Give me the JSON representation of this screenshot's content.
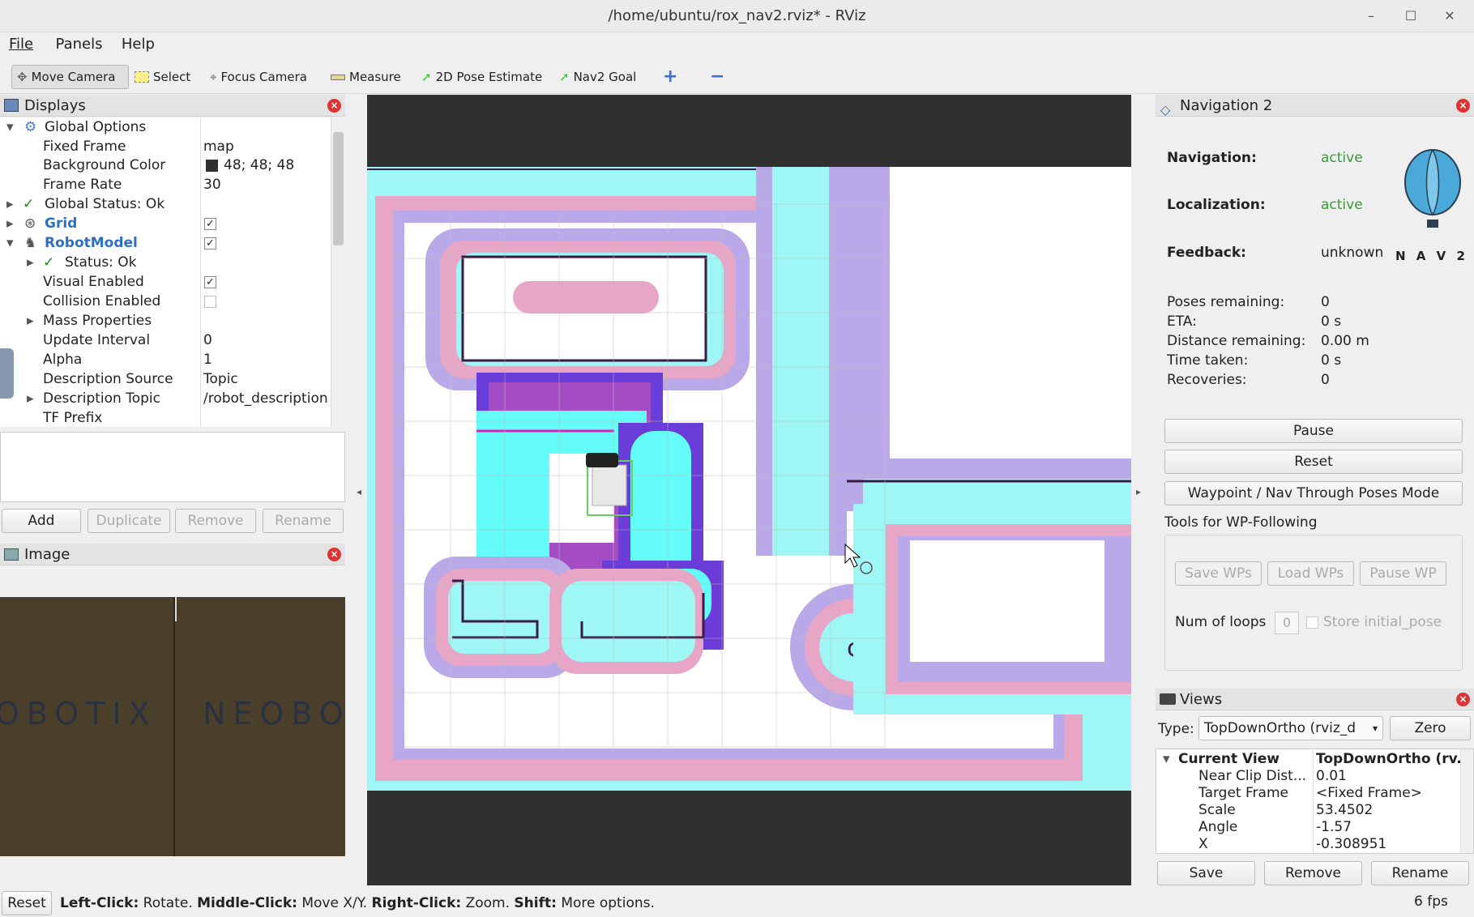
{
  "window": {
    "title": "/home/ubuntu/rox_nav2.rviz* - RViz",
    "minimize": "–",
    "maximize": "☐",
    "close": "✕"
  },
  "menu": [
    "File",
    "Panels",
    "Help"
  ],
  "toolbar": {
    "move_camera": "Move Camera",
    "select": "Select",
    "focus_camera": "Focus Camera",
    "measure": "Measure",
    "pose_estimate": "2D Pose Estimate",
    "nav2_goal": "Nav2 Goal",
    "plus": "+",
    "minus": "−"
  },
  "displays": {
    "title": "Displays",
    "rows": [
      {
        "label": "Global Options",
        "value": ""
      },
      {
        "label": "Fixed Frame",
        "value": "map"
      },
      {
        "label": "Background Color",
        "value": "48; 48; 48"
      },
      {
        "label": "Frame Rate",
        "value": "30"
      },
      {
        "label": "Global Status: Ok",
        "value": ""
      },
      {
        "label": "Grid",
        "value": ""
      },
      {
        "label": "RobotModel",
        "value": ""
      },
      {
        "label": "Status: Ok",
        "value": ""
      },
      {
        "label": "Visual Enabled",
        "value": ""
      },
      {
        "label": "Collision Enabled",
        "value": ""
      },
      {
        "label": "Mass Properties",
        "value": ""
      },
      {
        "label": "Update Interval",
        "value": "0"
      },
      {
        "label": "Alpha",
        "value": "1"
      },
      {
        "label": "Description Source",
        "value": "Topic"
      },
      {
        "label": "Description Topic",
        "value": "/robot_description"
      },
      {
        "label": "TF Prefix",
        "value": ""
      }
    ],
    "buttons": {
      "add": "Add",
      "duplicate": "Duplicate",
      "remove": "Remove",
      "rename": "Rename"
    }
  },
  "image_panel": {
    "title": "Image",
    "text_left": "OBOTIX",
    "text_right": "NEOBOT"
  },
  "nav2": {
    "title": "Navigation 2",
    "navigation_label": "Navigation:",
    "navigation_value": "active",
    "localization_label": "Localization:",
    "localization_value": "active",
    "feedback_label": "Feedback:",
    "feedback_value": "unknown",
    "logo_text": "N A V 2",
    "stats": [
      {
        "label": "Poses remaining:",
        "value": "0"
      },
      {
        "label": "ETA:",
        "value": "0 s"
      },
      {
        "label": "Distance remaining:",
        "value": "0.00 m"
      },
      {
        "label": "Time taken:",
        "value": "0 s"
      },
      {
        "label": "Recoveries:",
        "value": "0"
      }
    ],
    "pause": "Pause",
    "reset": "Reset",
    "waypoint_mode": "Waypoint / Nav Through Poses Mode",
    "tools_title": "Tools for WP-Following",
    "save_wps": "Save WPs",
    "load_wps": "Load WPs",
    "pause_wp": "Pause WP",
    "num_loops_label": "Num of loops",
    "num_loops_value": "0",
    "store_initial": "Store initial_pose",
    "active_color": "#3a9a3a"
  },
  "views": {
    "title": "Views",
    "type_label": "Type:",
    "type_value": "TopDownOrtho (rviz_d",
    "zero": "Zero",
    "rows": [
      {
        "label": "Current View",
        "value": "TopDownOrtho (rv..."
      },
      {
        "label": "Near Clip Dist...",
        "value": "0.01"
      },
      {
        "label": "Target Frame",
        "value": "<Fixed Frame>"
      },
      {
        "label": "Scale",
        "value": "53.4502"
      },
      {
        "label": "Angle",
        "value": "-1.57"
      },
      {
        "label": "X",
        "value": "-0.308951"
      }
    ],
    "save": "Save",
    "remove": "Remove",
    "rename": "Rename"
  },
  "statusbar": {
    "reset": "Reset",
    "hint1_key": "Left-Click:",
    "hint1": "Rotate.",
    "hint2_key": "Middle-Click:",
    "hint2": "Move X/Y.",
    "hint3_key": "Right-Click:",
    "hint3": "Zoom.",
    "hint4_key": "Shift:",
    "hint4": "More options.",
    "fps": "6 fps"
  }
}
